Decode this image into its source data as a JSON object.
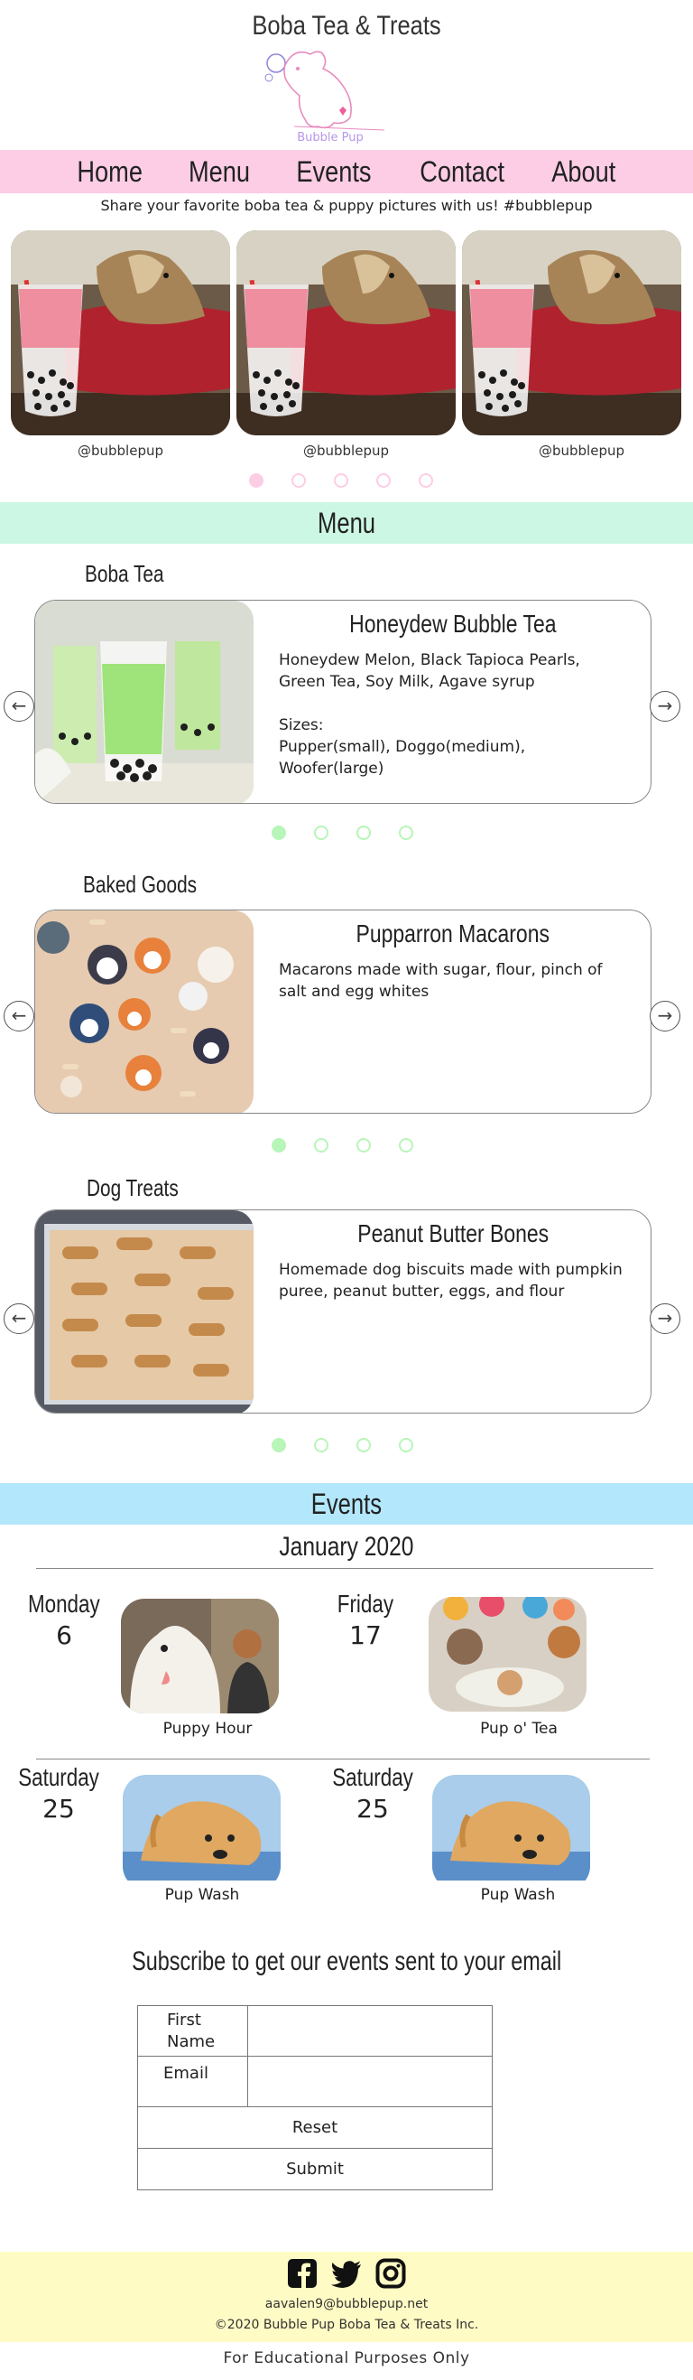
{
  "site": {
    "title": "Boba Tea & Treats",
    "logo_text": "Bubble Pup"
  },
  "nav": {
    "items": [
      "Home",
      "Menu",
      "Events",
      "Contact",
      "About"
    ]
  },
  "share": {
    "text": "Share your favorite boba tea & puppy pictures with us! #bubblepup",
    "captions": [
      "@bubblepup",
      "@bubblepup",
      "@bubblepup"
    ],
    "active_dot": 1
  },
  "menu": {
    "heading": "Menu",
    "sections": [
      {
        "category": "Boba Tea",
        "name": "Honeydew Bubble Tea",
        "description": "Honeydew Melon, Black Tapioca Pearls,\nGreen Tea, Soy Milk, Agave syrup\n\nSizes:\nPupper(small), Doggo(medium),\nWoofer(large)"
      },
      {
        "category": "Baked Goods",
        "name": "Pupparron Macarons",
        "description": "Macarons made with sugar, flour, pinch of\nsalt and egg whites"
      },
      {
        "category": "Dog Treats",
        "name": "Peanut Butter Bones",
        "description": "Homemade dog biscuits made with pumpkin\npuree, peanut butter, eggs, and flour"
      }
    ]
  },
  "events": {
    "heading": "Events",
    "month": "January 2020",
    "items": [
      {
        "day": "Monday",
        "date": "6",
        "name": "Puppy Hour"
      },
      {
        "day": "Friday",
        "date": "17",
        "name": "Pup o' Tea"
      },
      {
        "day": "Saturday",
        "date": "25",
        "name": "Pup Wash"
      },
      {
        "day": "Saturday",
        "date": "25",
        "name": "Pup Wash"
      }
    ]
  },
  "subscribe": {
    "heading": "Subscribe to get our events sent to your email",
    "first_name_label": "First Name",
    "email_label": "Email",
    "first_name_value": "",
    "email_value": "",
    "reset_label": "Reset",
    "submit_label": "Submit"
  },
  "footer": {
    "social_icons": [
      "facebook-icon",
      "twitter-icon",
      "instagram-icon"
    ],
    "email": "aavalen9@bubblepup.net",
    "copyright": "©2020 Bubble Pup Boba Tea & Treats Inc.",
    "note": "For Educational Purposes Only"
  },
  "colors": {
    "nav_pink": "#fccde5",
    "menu_mint": "#ccf7e4",
    "events_blue": "#b3e7fb",
    "footer_yellow": "#fffbc5",
    "dot_green": "#b8f5b8"
  }
}
